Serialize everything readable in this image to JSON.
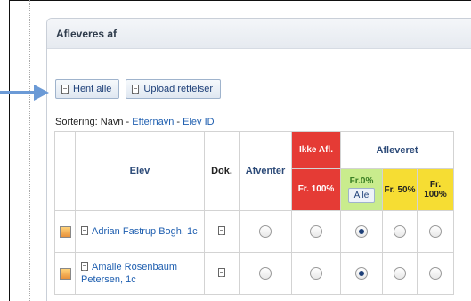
{
  "panel": {
    "title": "Afleveres af"
  },
  "buttons": {
    "fetch_all": "Hent alle",
    "upload": "Upload rettelser"
  },
  "sorting": {
    "prefix": "Sortering:",
    "name": "Navn",
    "sep1": " - ",
    "lastname": "Efternavn",
    "sep2": " - ",
    "id": "Elev ID"
  },
  "table": {
    "col_elev": "Elev",
    "col_dok": "Dok.",
    "col_afventer": "Afventer",
    "col_ikke_top": "Ikke Afl.",
    "col_ikke_bottom": "Fr. 100%",
    "group_afleveret": "Afleveret",
    "fr0": "Fr.0%",
    "alle": "Alle",
    "fr50": "Fr. 50%",
    "fr100": "Fr. 100%",
    "rows": [
      {
        "name": "Adrian Fastrup Bogh, 1c",
        "selected": "fr0"
      },
      {
        "name": "Amalie Rosenbaum Petersen, 1c",
        "selected": "fr0"
      }
    ]
  },
  "colors": {
    "ikke": "#e53b35",
    "fr0": "#c9ec8d",
    "fr_yellow": "#f6dd33",
    "arrow": "#6b9ad6"
  }
}
